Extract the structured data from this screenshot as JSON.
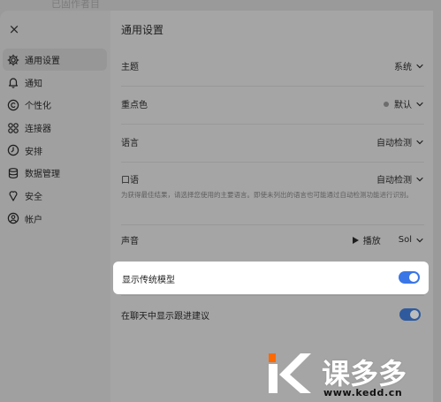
{
  "background": {
    "partial_text": "已固作者目"
  },
  "sidebar": {
    "close_label": "×",
    "items": [
      {
        "label": "通用设置",
        "icon": "gear-icon",
        "active": true
      },
      {
        "label": "通知",
        "icon": "bell-icon",
        "active": false
      },
      {
        "label": "个性化",
        "icon": "personalize-icon",
        "active": false
      },
      {
        "label": "连接器",
        "icon": "connectors-icon",
        "active": false
      },
      {
        "label": "安排",
        "icon": "clock-icon",
        "active": false
      },
      {
        "label": "数据管理",
        "icon": "database-icon",
        "active": false
      },
      {
        "label": "安全",
        "icon": "shield-icon",
        "active": false
      },
      {
        "label": "帐户",
        "icon": "account-icon",
        "active": false
      }
    ]
  },
  "main": {
    "title": "通用设置",
    "theme": {
      "label": "主题",
      "value": "系统"
    },
    "accent": {
      "label": "重点色",
      "value": "默认"
    },
    "language": {
      "label": "语言",
      "value": "自动检测"
    },
    "spoken": {
      "label": "口语",
      "value": "自动检测",
      "hint": "为获得最佳结果，请选择您使用的主要语言。即使未列出的语言也可能通过自动检测功能进行识别。"
    },
    "voice": {
      "label": "声音",
      "play_label": "播放",
      "voice_name": "Sol"
    },
    "legacy_models": {
      "label": "显示传统模型",
      "enabled": true
    },
    "follow_up": {
      "label": "在聊天中显示跟进建议",
      "enabled": true
    }
  },
  "watermark": {
    "brand": "课多多",
    "url": "www.kedd.cn",
    "brand_color": "#ff6a00"
  }
}
